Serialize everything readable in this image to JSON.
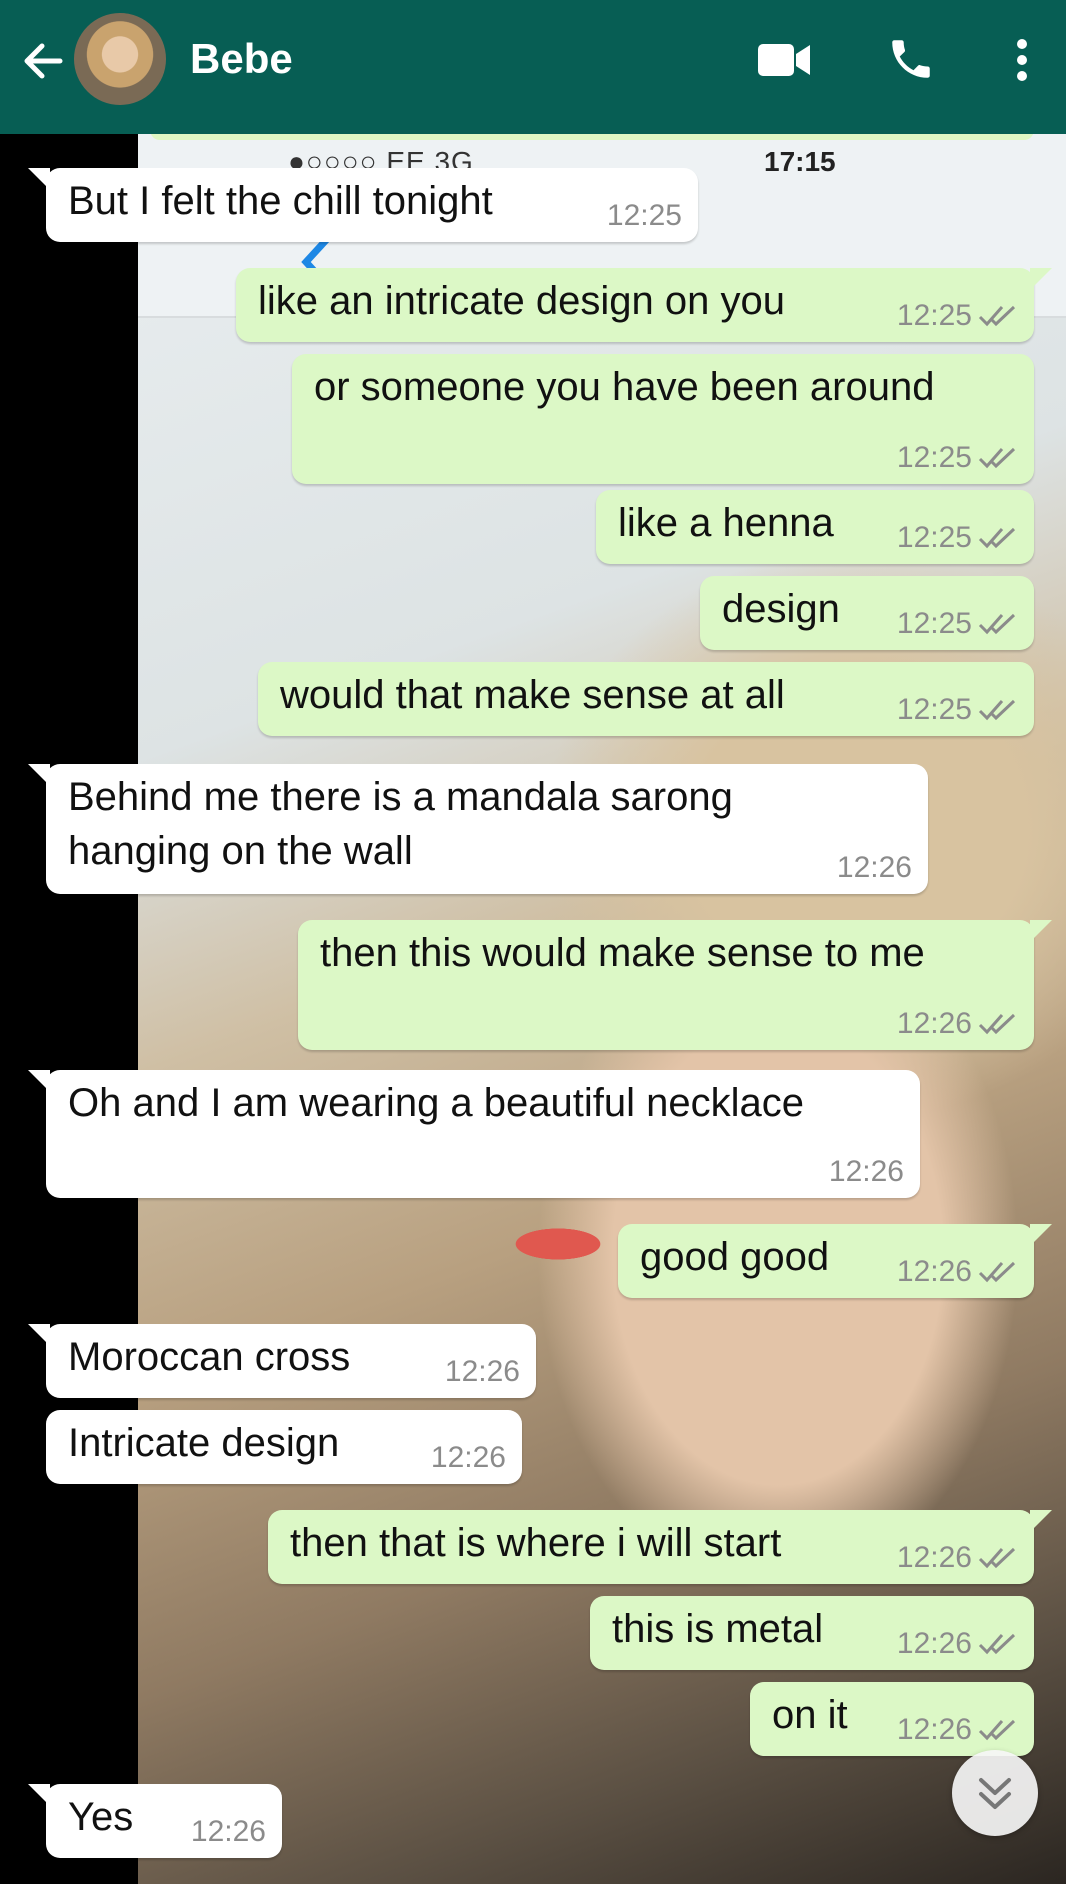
{
  "header": {
    "contact_name": "Bebe",
    "icons": [
      "back-arrow-icon",
      "avatar",
      "video-call-icon",
      "phone-icon",
      "more-vert-icon"
    ],
    "color": "#075e54"
  },
  "background_screenshot": {
    "status": "●○○○○ EE   3G",
    "clock": "17:15"
  },
  "messages": [
    {
      "dir": "in",
      "text": "But I felt the chill tonight",
      "time": "12:25"
    },
    {
      "dir": "out",
      "text": "like an intricate design on you",
      "time": "12:25"
    },
    {
      "dir": "out",
      "text": "or someone you have been around",
      "time": "12:25"
    },
    {
      "dir": "out",
      "text": "like a henna",
      "time": "12:25"
    },
    {
      "dir": "out",
      "text": "design",
      "time": "12:25"
    },
    {
      "dir": "out",
      "text": "would that make sense at all",
      "time": "12:25"
    },
    {
      "dir": "in",
      "text": "Behind me there is a mandala sarong\nhanging on the wall",
      "time": "12:26"
    },
    {
      "dir": "out",
      "text": "then this would make sense to me",
      "time": "12:26"
    },
    {
      "dir": "in",
      "text": "Oh and I am wearing a beautiful necklace",
      "time": "12:26"
    },
    {
      "dir": "out",
      "text": "good good",
      "time": "12:26"
    },
    {
      "dir": "in",
      "text": "Moroccan cross",
      "time": "12:26"
    },
    {
      "dir": "in",
      "text": "Intricate design",
      "time": "12:26"
    },
    {
      "dir": "out",
      "text": "then that is where i will start",
      "time": "12:26"
    },
    {
      "dir": "out",
      "text": "this is metal",
      "time": "12:26"
    },
    {
      "dir": "out",
      "text": "on it",
      "time": "12:26"
    },
    {
      "dir": "in",
      "text": "Yes",
      "time": "12:26"
    }
  ],
  "colors": {
    "outgoing": "#dcf8c6",
    "incoming": "#ffffff",
    "tick": "#8b8b8b"
  }
}
